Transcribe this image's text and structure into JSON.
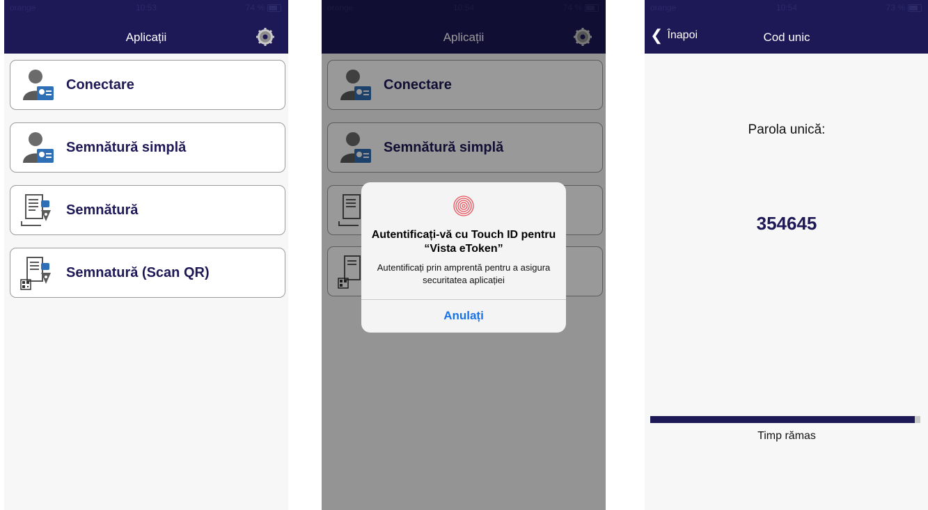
{
  "screens": [
    {
      "status": {
        "carrier": "orange",
        "time": "10:53",
        "battery": "74 %"
      },
      "nav_title": "Aplicații",
      "buttons": [
        {
          "label": "Conectare",
          "icon": "user-badge-icon"
        },
        {
          "label": "Semnătură simplă",
          "icon": "user-badge-icon"
        },
        {
          "label": "Semnătură",
          "icon": "document-pen-icon"
        },
        {
          "label": "Semnatură (Scan QR)",
          "icon": "qr-document-pen-icon"
        }
      ]
    },
    {
      "status": {
        "carrier": "orange",
        "time": "10:54",
        "battery": "74 %"
      },
      "nav_title": "Aplicații",
      "buttons": [
        {
          "label": "Conectare",
          "icon": "user-badge-icon"
        },
        {
          "label": "Semnătură simplă",
          "icon": "user-badge-icon"
        }
      ],
      "dialog": {
        "title": "Autentificați-vă cu Touch ID pentru “Vista eToken”",
        "subtitle": "Autentificați prin amprentă pentru a asigura securitatea aplicației",
        "cancel": "Anulați",
        "icon": "fingerprint-icon"
      }
    },
    {
      "status": {
        "carrier": "orange",
        "time": "10:54",
        "battery": "73 %"
      },
      "back_label": "Înapoi",
      "nav_title": "Cod unic",
      "otp_label": "Parola unică:",
      "otp_code": "354645",
      "time_left_label": "Timp rămas",
      "progress_fraction": 0.98
    }
  ],
  "colors": {
    "navbar": "#1d1856",
    "accent_text": "#1d1856",
    "dialog_button": "#1a73e8"
  }
}
